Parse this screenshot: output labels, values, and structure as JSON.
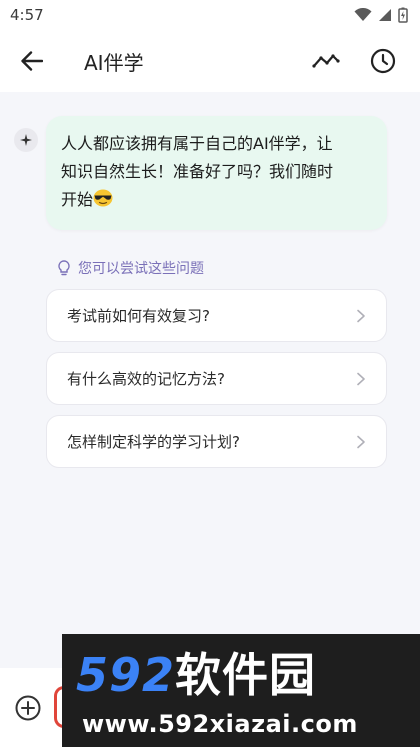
{
  "status_bar": {
    "time": "4:57"
  },
  "app_bar": {
    "title": "AI伴学"
  },
  "chat": {
    "bot_message_lines": [
      "人人都应该拥有属于自己的AI伴学，让",
      "知识自然生长！准备好了吗？我们随时",
      "开始"
    ],
    "emoji": "sunglasses-emoji"
  },
  "suggestions": {
    "header": "您可以尝试这些问题",
    "items": [
      {
        "label": "考试前如何有效复习?"
      },
      {
        "label": "有什么高效的记忆方法?"
      },
      {
        "label": "怎样制定科学的学习计划?"
      }
    ]
  },
  "watermark": {
    "brand_num": "592",
    "brand_cn": "软件园",
    "url": "www.592xiazai.com"
  },
  "colors": {
    "bubble_bg": "#e8f8f0",
    "accent_purple": "#7a70b8",
    "mic_red": "#e0453a",
    "watermark_blue": "#3b82f6"
  }
}
